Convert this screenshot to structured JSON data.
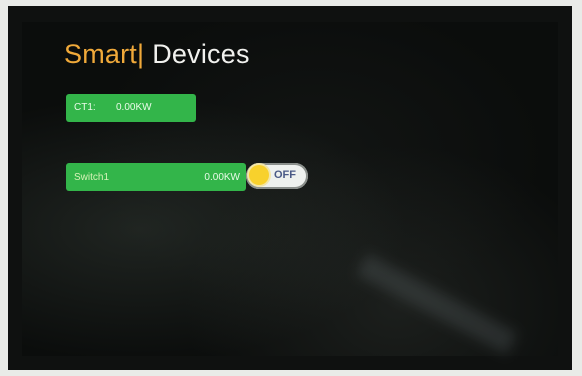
{
  "header": {
    "title_smart": "Smart",
    "title_separator": "|",
    "title_devices": "Devices"
  },
  "devices": {
    "ct1": {
      "name": "CT1:",
      "value": "0.00KW"
    },
    "switch1": {
      "name": "Switch1",
      "value": "0.00KW",
      "toggle_label": "OFF"
    }
  },
  "colors": {
    "accent": "#f0a93a",
    "card": "#33b54a",
    "knob": "#f8d12c"
  }
}
